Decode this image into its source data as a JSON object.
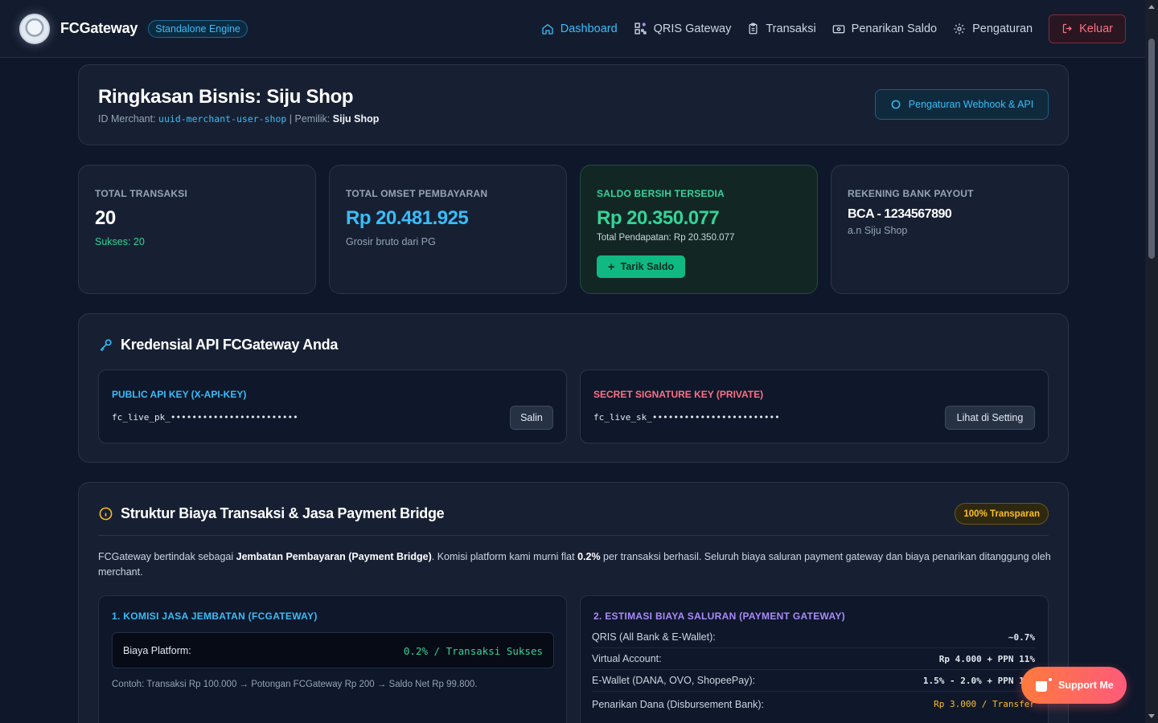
{
  "nav": {
    "brand": "FCGateway",
    "badge": "Standalone Engine",
    "links": [
      {
        "label": "Dashboard",
        "icon": "home-icon",
        "active": true
      },
      {
        "label": "QRIS Gateway",
        "icon": "qr-code-icon"
      },
      {
        "label": "Transaksi",
        "icon": "clipboard-icon"
      },
      {
        "label": "Penarikan Saldo",
        "icon": "wallet-icon"
      },
      {
        "label": "Pengaturan",
        "icon": "gear-icon"
      }
    ],
    "logout": "Keluar"
  },
  "summary": {
    "title": "Ringkasan Bisnis: Siju Shop",
    "merchant_id_label": "ID Merchant:",
    "merchant_id": "uuid-merchant-user-shop",
    "separator": "|",
    "owner_label": "Pemilik:",
    "owner": "Siju Shop",
    "webhook_button": "Pengaturan Webhook & API"
  },
  "stats": {
    "total_transaksi": {
      "label": "TOTAL TRANSAKSI",
      "value": "20",
      "sub": "Sukses: 20"
    },
    "total_omset": {
      "label": "TOTAL OMSET PEMBAYARAN",
      "value": "Rp 20.481.925",
      "sub": "Grosir bruto dari PG"
    },
    "saldo": {
      "label": "SALDO BERSIH TERSEDIA",
      "value": "Rp 20.350.077",
      "sub": "Total Pendapatan: Rp 20.350.077",
      "button": "Tarik Saldo"
    },
    "rekening": {
      "label": "REKENING BANK PAYOUT",
      "value": "BCA - 1234567890",
      "sub": "a.n Siju Shop"
    }
  },
  "credentials": {
    "title": "Kredensial API FCGateway Anda",
    "public": {
      "label": "PUBLIC API KEY (X-API-KEY)",
      "value": "fc_live_pk_••••••••••••••••••••••••",
      "button": "Salin"
    },
    "secret": {
      "label": "SECRET SIGNATURE KEY (PRIVATE)",
      "value": "fc_live_sk_••••••••••••••••••••••••",
      "button": "Lihat di Setting"
    }
  },
  "fees": {
    "title": "Struktur Biaya Transaksi & Jasa Payment Bridge",
    "badge": "100% Transparan",
    "desc_1": "FCGateway bertindak sebagai ",
    "desc_bold_1": "Jembatan Pembayaran (Payment Bridge)",
    "desc_2": ". Komisi platform kami murni flat ",
    "desc_bold_2": "0.2%",
    "desc_3": " per transaksi berhasil. Seluruh biaya saluran payment gateway dan biaya penarikan ditanggung oleh merchant.",
    "commission": {
      "title": "1. KOMISI JASA JEMBATAN (FCGATEWAY)",
      "label": "Biaya Platform:",
      "value": "0.2% / Transaksi Sukses",
      "example": "Contoh: Transaksi Rp 100.000 → Potongan FCGateway Rp 200 → Saldo Net Rp 99.800."
    },
    "channels": {
      "title": "2. ESTIMASI BIAYA SALURAN (PAYMENT GATEWAY)",
      "rows": [
        {
          "label": "QRIS (All Bank & E-Wallet):",
          "value": "~0.7%"
        },
        {
          "label": "Virtual Account:",
          "value": "Rp 4.000 + PPN 11%"
        },
        {
          "label": "E-Wallet (DANA, OVO, ShopeePay):",
          "value": "1.5% - 2.0% + PPN 11%"
        },
        {
          "label": "Penarikan Dana (Disbursement Bank):",
          "value": "Rp 3.000 / Transfer"
        }
      ]
    }
  },
  "support": {
    "label": "Support Me"
  },
  "colors": {
    "accent": "#38bdf8",
    "success": "#34d399",
    "danger": "#fb7185",
    "warning": "#fbbf24",
    "background": "#0f172a",
    "card": "#172033"
  }
}
